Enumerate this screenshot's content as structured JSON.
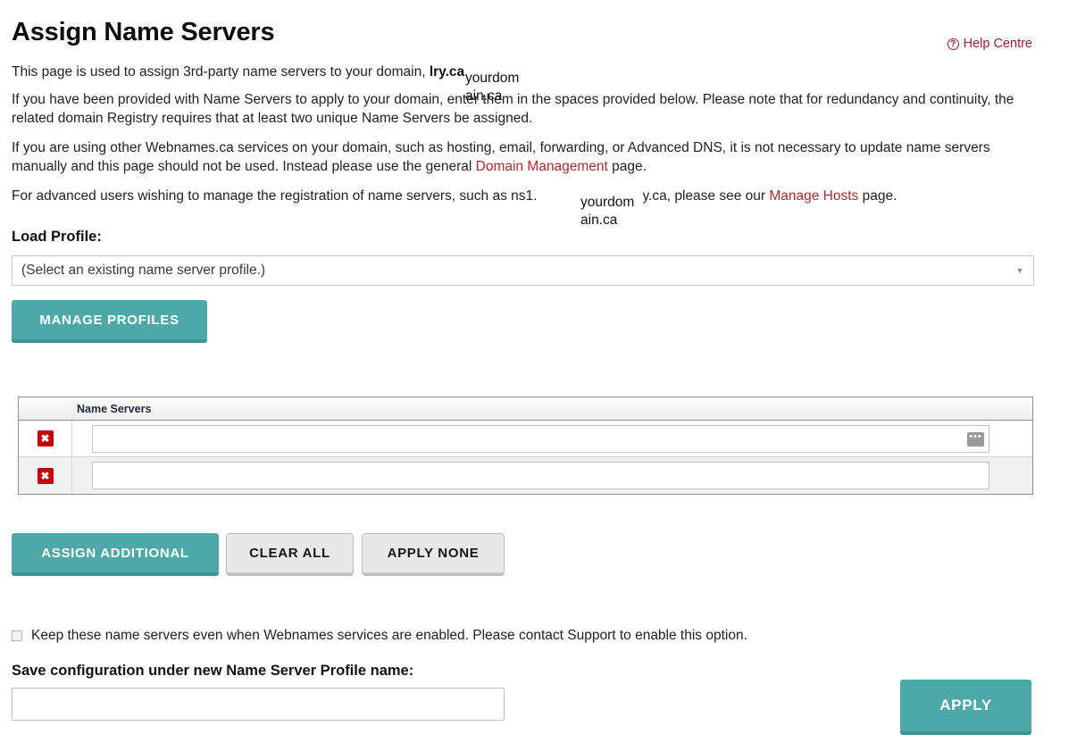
{
  "header": {
    "title": "Assign Name Servers",
    "help_link": "Help Centre",
    "help_icon": "question-circle-icon",
    "help_icon_glyph": "?"
  },
  "intro": {
    "para1_before": "This page is used to assign 3rd-party name servers to your domain, ",
    "para1_domain_bold": "lry.ca",
    "para1_after": ".",
    "para2": "If you have been provided with Name Servers to apply to your domain, enter them in the spaces provided below. Please note that for redundancy and continuity, the related domain Registry requires that at least two unique Name Servers be assigned.",
    "para3_before": "If you are using other Webnames.ca services on your domain, such as hosting, email, forwarding, or Advanced DNS, it is not necessary to update name servers manually and this page should not be used. Instead please use the general ",
    "para3_link": "Domain Management",
    "para3_after": " page.",
    "para4_before": "For advanced users wishing to manage the registration of name servers, such as ns1.",
    "para4_mid": "y.ca, please see our ",
    "para4_link": "Manage Hosts",
    "para4_after": " page.",
    "overlay_domain": "yourdomain.ca"
  },
  "load_profile": {
    "label": "Load Profile:",
    "selected_value": "(Select an existing name server profile.)",
    "arrow_icon": "chevron-down-icon",
    "arrow_glyph": "▼",
    "manage_profiles_button": "MANAGE PROFILES"
  },
  "name_servers": {
    "column_header": "Name Servers",
    "delete_icon": "close-x-icon",
    "delete_glyph": "✖",
    "autofill_icon": "ellipsis-autofill-icon",
    "autofill_glyph": "•••",
    "rows": [
      {
        "value": "",
        "placeholder": ""
      },
      {
        "value": "",
        "placeholder": ""
      }
    ]
  },
  "actions": {
    "assign_additional": "ASSIGN ADDITIONAL",
    "clear_all": "CLEAR ALL",
    "apply_none": "APPLY NONE"
  },
  "keep_option": {
    "checked": false,
    "label": "Keep these name servers even when Webnames services are enabled. Please contact Support to enable this option."
  },
  "save_config": {
    "label": "Save configuration under new Name Server Profile name:",
    "value": "",
    "placeholder": "",
    "apply_button": "APPLY"
  },
  "colors": {
    "teal": "#4da8a8",
    "teal_shadow": "#3f9292",
    "link_red": "#b0282f",
    "help_red": "#9c1f2e",
    "delete_red": "#c60000"
  }
}
